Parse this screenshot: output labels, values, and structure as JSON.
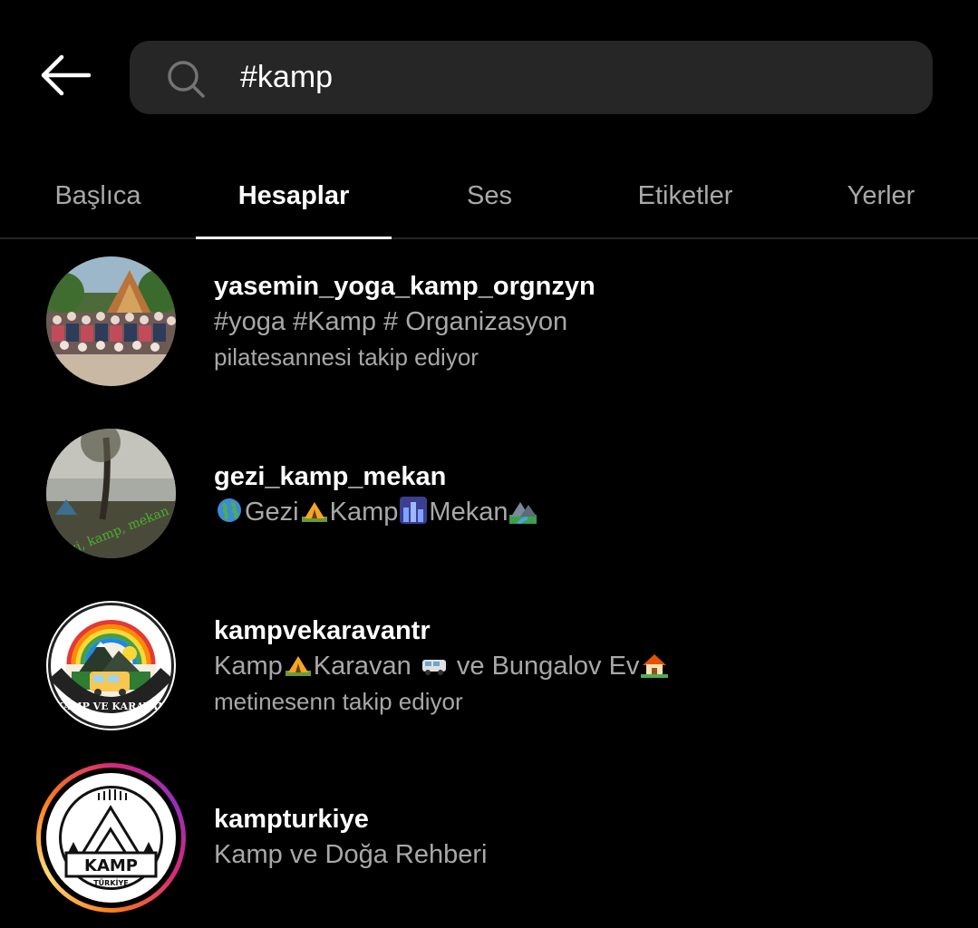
{
  "search": {
    "query": "#kamp"
  },
  "tabs": [
    {
      "label": "Başlıca",
      "active": false
    },
    {
      "label": "Hesaplar",
      "active": true
    },
    {
      "label": "Ses",
      "active": false
    },
    {
      "label": "Etiketler",
      "active": false
    },
    {
      "label": "Yerler",
      "active": false
    }
  ],
  "accounts": [
    {
      "username": "yasemin_yoga_kamp_orgnzyn",
      "bio": "#yoga #Kamp # Organizasyon",
      "followed_by": "pilatesannesi takip ediyor"
    },
    {
      "username": "gezi_kamp_mekan",
      "bio_parts": [
        "Gezi",
        "Kamp",
        "Mekan"
      ],
      "bio_icons": [
        "globe-emoji",
        "tent-emoji",
        "cityscape-emoji",
        "mountain-river-emoji"
      ],
      "avatar_text": "gezi, kamp, mekan"
    },
    {
      "username": "kampvekaravantr",
      "bio_parts": [
        "Kamp",
        "Karavan ",
        " ve Bungalov Ev"
      ],
      "bio_icons": [
        "tent-emoji",
        "van-emoji",
        "house-emoji"
      ],
      "followed_by": "metinesenn takip ediyor",
      "avatar_text": "KAMP VE KARAVAN"
    },
    {
      "username": "kampturkiye",
      "bio": "Kamp ve Doğa Rehberi",
      "avatar_text_main": "KAMP",
      "avatar_text_sub": "TÜRKİYE",
      "has_story": true
    }
  ]
}
